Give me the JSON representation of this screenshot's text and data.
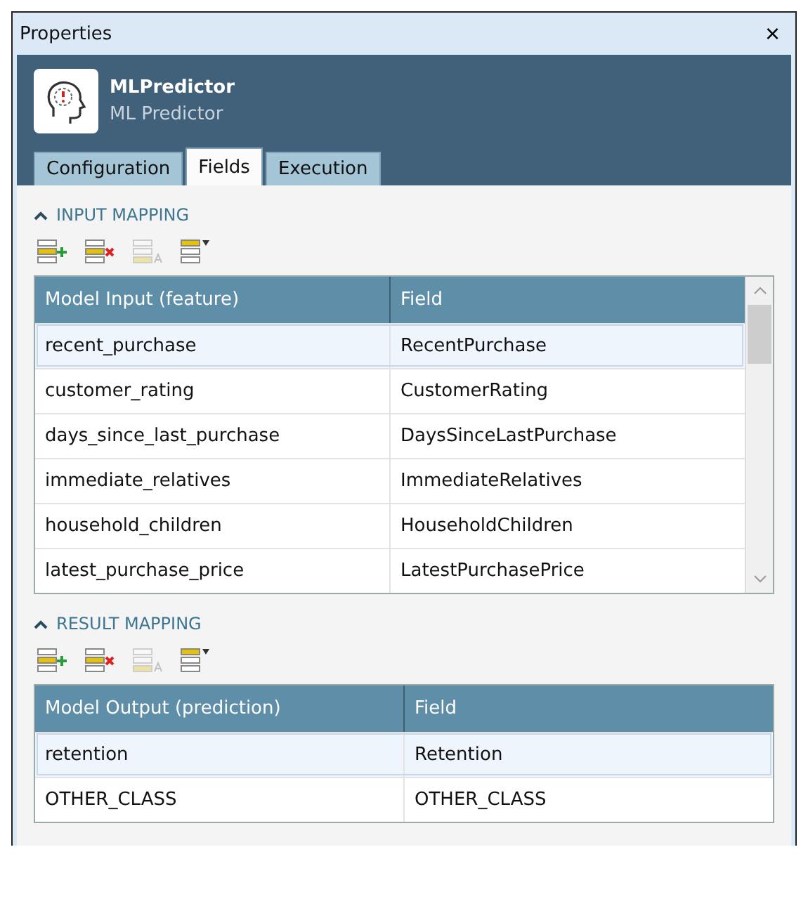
{
  "window": {
    "title": "Properties",
    "close": "×"
  },
  "header": {
    "name": "MLPredictor",
    "type": "ML Predictor"
  },
  "tabs": [
    {
      "label": "Configuration",
      "selected": false
    },
    {
      "label": "Fields",
      "selected": true
    },
    {
      "label": "Execution",
      "selected": false
    }
  ],
  "sections": [
    {
      "title": "INPUT MAPPING",
      "expanded": true,
      "toolbar": [
        {
          "kind": "add",
          "disabled": false
        },
        {
          "kind": "remove",
          "disabled": false
        },
        {
          "kind": "rename",
          "disabled": true
        },
        {
          "kind": "menu",
          "disabled": false
        }
      ],
      "columns": [
        "Model Input (feature)",
        "Field"
      ],
      "scrollable": true,
      "rows": [
        {
          "cells": [
            "recent_purchase",
            "RecentPurchase"
          ],
          "selected": true
        },
        {
          "cells": [
            "customer_rating",
            "CustomerRating"
          ],
          "selected": false
        },
        {
          "cells": [
            "days_since_last_purchase",
            "DaysSinceLastPurchase"
          ],
          "selected": false
        },
        {
          "cells": [
            "immediate_relatives",
            "ImmediateRelatives"
          ],
          "selected": false
        },
        {
          "cells": [
            "household_children",
            "HouseholdChildren"
          ],
          "selected": false
        },
        {
          "cells": [
            "latest_purchase_price",
            "LatestPurchasePrice"
          ],
          "selected": false
        }
      ]
    },
    {
      "title": "RESULT MAPPING",
      "expanded": true,
      "toolbar": [
        {
          "kind": "add",
          "disabled": false
        },
        {
          "kind": "remove",
          "disabled": false
        },
        {
          "kind": "rename",
          "disabled": true
        },
        {
          "kind": "menu",
          "disabled": false
        }
      ],
      "columns": [
        "Model Output (prediction)",
        "Field"
      ],
      "scrollable": false,
      "rows": [
        {
          "cells": [
            "retention",
            "Retention"
          ],
          "selected": true
        },
        {
          "cells": [
            "OTHER_CLASS",
            "OTHER_CLASS"
          ],
          "selected": false
        }
      ]
    }
  ]
}
